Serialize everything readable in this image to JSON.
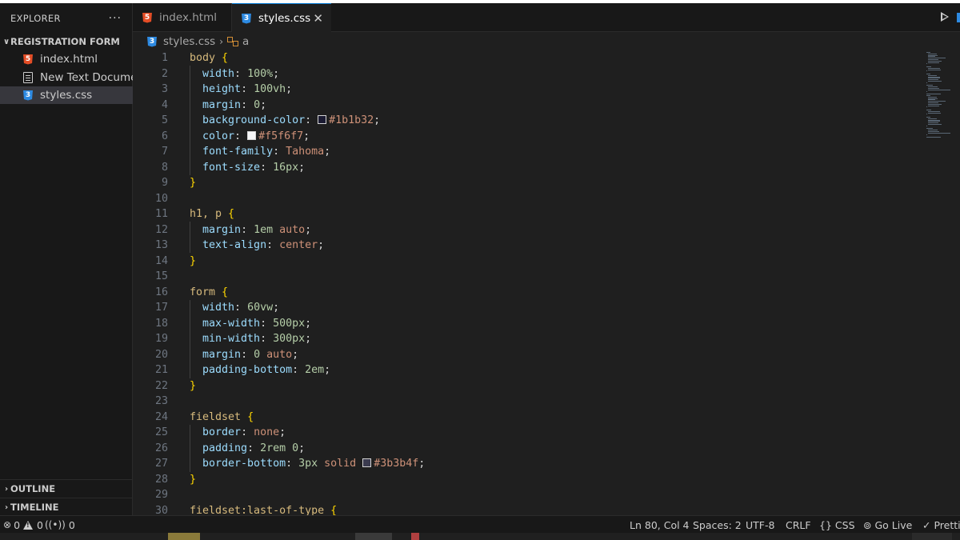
{
  "sidebar": {
    "title": "EXPLORER",
    "more": "···",
    "folder": "REGISTRATION FORM",
    "files": [
      {
        "label": "index.html",
        "icon": "html-file-icon"
      },
      {
        "label": "New Text Document.txt",
        "icon": "text-file-icon"
      },
      {
        "label": "styles.css",
        "icon": "css-file-icon"
      }
    ],
    "outline": "OUTLINE",
    "timeline": "TIMELINE"
  },
  "tabs": [
    {
      "label": "index.html",
      "icon": "html-file-icon",
      "active": false
    },
    {
      "label": "styles.css",
      "icon": "css-file-icon",
      "active": true,
      "close": "✕"
    }
  ],
  "breadcrumb": {
    "file": "styles.css",
    "symbol": "a"
  },
  "code_lines": [
    {
      "n": "1",
      "text": "body {"
    },
    {
      "n": "2",
      "text": "  width: 100%;"
    },
    {
      "n": "3",
      "text": "  height: 100vh;"
    },
    {
      "n": "4",
      "text": "  margin: 0;"
    },
    {
      "n": "5",
      "text": "  background-color: #1b1b32;"
    },
    {
      "n": "6",
      "text": "  color: #f5f6f7;"
    },
    {
      "n": "7",
      "text": "  font-family: Tahoma;"
    },
    {
      "n": "8",
      "text": "  font-size: 16px;"
    },
    {
      "n": "9",
      "text": "}"
    },
    {
      "n": "10",
      "text": ""
    },
    {
      "n": "11",
      "text": "h1, p {"
    },
    {
      "n": "12",
      "text": "  margin: 1em auto;"
    },
    {
      "n": "13",
      "text": "  text-align: center;"
    },
    {
      "n": "14",
      "text": "}"
    },
    {
      "n": "15",
      "text": ""
    },
    {
      "n": "16",
      "text": "form {"
    },
    {
      "n": "17",
      "text": "  width: 60vw;"
    },
    {
      "n": "18",
      "text": "  max-width: 500px;"
    },
    {
      "n": "19",
      "text": "  min-width: 300px;"
    },
    {
      "n": "20",
      "text": "  margin: 0 auto;"
    },
    {
      "n": "21",
      "text": "  padding-bottom: 2em;"
    },
    {
      "n": "22",
      "text": "}"
    },
    {
      "n": "23",
      "text": ""
    },
    {
      "n": "24",
      "text": "fieldset {"
    },
    {
      "n": "25",
      "text": "  border: none;"
    },
    {
      "n": "26",
      "text": "  padding: 2rem 0;"
    },
    {
      "n": "27",
      "text": "  border-bottom: 3px solid #3b3b4f;"
    },
    {
      "n": "28",
      "text": "}"
    },
    {
      "n": "29",
      "text": ""
    },
    {
      "n": "30",
      "text": "fieldset:last-of-type {"
    }
  ],
  "colors": {
    "swatch_1": "#1b1b32",
    "swatch_2": "#f5f6f7",
    "swatch_3": "#3b3b4f",
    "accent": "#0078d4"
  },
  "statusbar": {
    "errors": "0",
    "warnings": "0",
    "ports": "0",
    "position": "Ln 80, Col 4",
    "spaces": "Spaces: 2",
    "encoding": "UTF-8",
    "eol": "CRLF",
    "language": "CSS",
    "golive": "Go Live",
    "prettier": "Prettier"
  }
}
